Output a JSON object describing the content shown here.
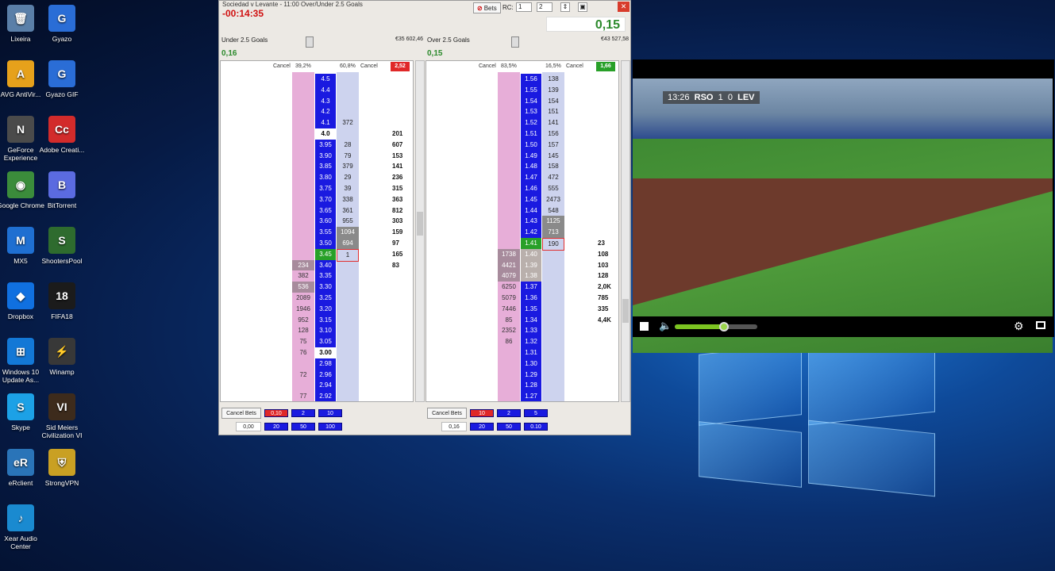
{
  "desktop_icons": [
    {
      "label": "Lixeira",
      "color": "#5a7fa8",
      "glyph": "🗑"
    },
    {
      "label": "Gyazo",
      "color": "#2a6dd6",
      "glyph": "G"
    },
    {
      "label": "AVG AntiVir...",
      "color": "#e6a11b",
      "glyph": "A"
    },
    {
      "label": "Gyazo GIF",
      "color": "#2a6dd6",
      "glyph": "G"
    },
    {
      "label": "GeForce Experience",
      "color": "#4b4b4b",
      "glyph": "N"
    },
    {
      "label": "Adobe Creati...",
      "color": "#d22b2b",
      "glyph": "Cc"
    },
    {
      "label": "Google Chrome",
      "color": "#3b8c3b",
      "glyph": "◉"
    },
    {
      "label": "BitTorrent",
      "color": "#5b6be0",
      "glyph": "B"
    },
    {
      "label": "MX5",
      "color": "#1f6fd1",
      "glyph": "M"
    },
    {
      "label": "ShootersPool",
      "color": "#2e6b2e",
      "glyph": "S"
    },
    {
      "label": "Dropbox",
      "color": "#1070e0",
      "glyph": "◆"
    },
    {
      "label": "FIFA18",
      "color": "#1b1b1b",
      "glyph": "18"
    },
    {
      "label": "Windows 10 Update As...",
      "color": "#1378d6",
      "glyph": "⊞"
    },
    {
      "label": "Winamp",
      "color": "#383838",
      "glyph": "⚡"
    },
    {
      "label": "Skype",
      "color": "#1ca1e6",
      "glyph": "S"
    },
    {
      "label": "Sid Meiers Civilization VI",
      "color": "#3d2b1c",
      "glyph": "VI"
    },
    {
      "label": "eRclient",
      "color": "#2a74b8",
      "glyph": "eR"
    },
    {
      "label": "StrongVPN",
      "color": "#c9a023",
      "glyph": "⛨"
    },
    {
      "label": "Xear Audio Center",
      "color": "#1a8ad0",
      "glyph": "♪"
    }
  ],
  "window": {
    "title": "Sociedad v Levante - 11:00 Over/Under 2.5 Goals",
    "timer": "-00:14:35",
    "bets_label": "Bets",
    "rc_label": "RC:",
    "rc1": "1",
    "rc2": "2",
    "close": "✕",
    "top_value": "0,15"
  },
  "under": {
    "name": "Under 2.5 Goals",
    "amount": "€35 602,46",
    "pl": "0,16",
    "head": {
      "cancel1": "Cancel",
      "pct1": "39,2%",
      "pct2": "60,8%",
      "cancel2": "Cancel",
      "badge": "2,52"
    },
    "rows": [
      {
        "odds": "4.5",
        "lay": "",
        "back": "",
        "vol": ""
      },
      {
        "odds": "4.4",
        "lay": "",
        "back": "",
        "vol": ""
      },
      {
        "odds": "4.3",
        "lay": "",
        "back": "",
        "vol": ""
      },
      {
        "odds": "4.2",
        "lay": "",
        "back": "",
        "vol": ""
      },
      {
        "odds": "4.1",
        "lay": "",
        "back": "372",
        "vol": ""
      },
      {
        "odds": "4.0",
        "lay": "",
        "back": "",
        "vol": "201",
        "style": "white"
      },
      {
        "odds": "3.95",
        "lay": "",
        "back": "28",
        "vol": "607"
      },
      {
        "odds": "3.90",
        "lay": "",
        "back": "79",
        "vol": "153"
      },
      {
        "odds": "3.85",
        "lay": "",
        "back": "379",
        "vol": "141"
      },
      {
        "odds": "3.80",
        "lay": "",
        "back": "29",
        "vol": "236"
      },
      {
        "odds": "3.75",
        "lay": "",
        "back": "39",
        "vol": "315"
      },
      {
        "odds": "3.70",
        "lay": "",
        "back": "338",
        "vol": "363"
      },
      {
        "odds": "3.65",
        "lay": "",
        "back": "361",
        "vol": "812"
      },
      {
        "odds": "3.60",
        "lay": "",
        "back": "955",
        "vol": "303"
      },
      {
        "odds": "3.55",
        "lay": "",
        "back": "1094",
        "vol": "159",
        "backstyle": "dark"
      },
      {
        "odds": "3.50",
        "lay": "",
        "back": "694",
        "vol": "97",
        "backstyle": "dark"
      },
      {
        "odds": "3.45",
        "lay": "",
        "back": "1",
        "vol": "165",
        "style": "green",
        "backstyle": "red"
      },
      {
        "odds": "3.40",
        "lay": "234",
        "back": "",
        "vol": "83",
        "laystyle": "dark"
      },
      {
        "odds": "3.35",
        "lay": "382",
        "back": "",
        "vol": ""
      },
      {
        "odds": "3.30",
        "lay": "536",
        "back": "",
        "vol": "",
        "laystyle": "dark"
      },
      {
        "odds": "3.25",
        "lay": "2089",
        "back": "",
        "vol": ""
      },
      {
        "odds": "3.20",
        "lay": "1946",
        "back": "",
        "vol": ""
      },
      {
        "odds": "3.15",
        "lay": "952",
        "back": "",
        "vol": ""
      },
      {
        "odds": "3.10",
        "lay": "128",
        "back": "",
        "vol": ""
      },
      {
        "odds": "3.05",
        "lay": "75",
        "back": "",
        "vol": ""
      },
      {
        "odds": "3.00",
        "lay": "76",
        "back": "",
        "vol": "",
        "style": "white"
      },
      {
        "odds": "2.98",
        "lay": "",
        "back": "",
        "vol": ""
      },
      {
        "odds": "2.96",
        "lay": "72",
        "back": "",
        "vol": ""
      },
      {
        "odds": "2.94",
        "lay": "",
        "back": "",
        "vol": ""
      },
      {
        "odds": "2.92",
        "lay": "77",
        "back": "",
        "vol": ""
      }
    ],
    "footer": {
      "cancel_bets": "Cancel Bets",
      "input": "0,00",
      "stakes_top": [
        "0,10",
        "2",
        "10"
      ],
      "stakes_bottom": [
        "20",
        "50",
        "100"
      ]
    }
  },
  "over": {
    "name": "Over 2.5 Goals",
    "amount": "€43 527,58",
    "pl": "0,15",
    "head": {
      "cancel1": "Cancel",
      "pct1": "83,5%",
      "pct2": "16,5%",
      "cancel2": "Cancel",
      "badge": "1,66"
    },
    "rows": [
      {
        "odds": "1.56",
        "lay": "",
        "back": "138",
        "vol": ""
      },
      {
        "odds": "1.55",
        "lay": "",
        "back": "139",
        "vol": ""
      },
      {
        "odds": "1.54",
        "lay": "",
        "back": "154",
        "vol": ""
      },
      {
        "odds": "1.53",
        "lay": "",
        "back": "151",
        "vol": ""
      },
      {
        "odds": "1.52",
        "lay": "",
        "back": "141",
        "vol": ""
      },
      {
        "odds": "1.51",
        "lay": "",
        "back": "156",
        "vol": ""
      },
      {
        "odds": "1.50",
        "lay": "",
        "back": "157",
        "vol": ""
      },
      {
        "odds": "1.49",
        "lay": "",
        "back": "145",
        "vol": ""
      },
      {
        "odds": "1.48",
        "lay": "",
        "back": "158",
        "vol": ""
      },
      {
        "odds": "1.47",
        "lay": "",
        "back": "472",
        "vol": ""
      },
      {
        "odds": "1.46",
        "lay": "",
        "back": "555",
        "vol": ""
      },
      {
        "odds": "1.45",
        "lay": "",
        "back": "2473",
        "vol": ""
      },
      {
        "odds": "1.44",
        "lay": "",
        "back": "548",
        "vol": ""
      },
      {
        "odds": "1.43",
        "lay": "",
        "back": "1125",
        "vol": "",
        "backstyle": "dark"
      },
      {
        "odds": "1.42",
        "lay": "",
        "back": "713",
        "vol": "",
        "backstyle": "dark"
      },
      {
        "odds": "1.41",
        "lay": "",
        "back": "190",
        "vol": "23",
        "style": "green",
        "backstyle": "red"
      },
      {
        "odds": "1.40",
        "lay": "1738",
        "back": "",
        "vol": "108",
        "style": "grey",
        "laystyle": "dark"
      },
      {
        "odds": "1.39",
        "lay": "4421",
        "back": "",
        "vol": "103",
        "style": "grey",
        "laystyle": "dark"
      },
      {
        "odds": "1.38",
        "lay": "4079",
        "back": "",
        "vol": "128",
        "style": "grey",
        "laystyle": "dark"
      },
      {
        "odds": "1.37",
        "lay": "6250",
        "back": "",
        "vol": "2,0K"
      },
      {
        "odds": "1.36",
        "lay": "5079",
        "back": "",
        "vol": "785"
      },
      {
        "odds": "1.35",
        "lay": "7446",
        "back": "",
        "vol": "335"
      },
      {
        "odds": "1.34",
        "lay": "85",
        "back": "",
        "vol": "4,4K"
      },
      {
        "odds": "1.33",
        "lay": "2352",
        "back": "",
        "vol": ""
      },
      {
        "odds": "1.32",
        "lay": "86",
        "back": "",
        "vol": ""
      },
      {
        "odds": "1.31",
        "lay": "",
        "back": "",
        "vol": ""
      },
      {
        "odds": "1.30",
        "lay": "",
        "back": "",
        "vol": ""
      },
      {
        "odds": "1.29",
        "lay": "",
        "back": "",
        "vol": ""
      },
      {
        "odds": "1.28",
        "lay": "",
        "back": "",
        "vol": ""
      },
      {
        "odds": "1.27",
        "lay": "",
        "back": "",
        "vol": ""
      }
    ],
    "footer": {
      "cancel_bets": "Cancel Bets",
      "input": "0,16",
      "stakes_top": [
        "10",
        "2",
        "5"
      ],
      "stakes_bottom": [
        "20",
        "50",
        "0.10"
      ]
    }
  },
  "video": {
    "score_time": "13:26",
    "home": "RSO",
    "home_goals": "1",
    "away_goals": "0",
    "away": "LEV",
    "volume_fraction": 0.6
  },
  "colors": {
    "accent_green": "#2c8a2c",
    "odds_blue": "#1a1ae0",
    "pink": "#e7aed8",
    "red": "#e02828"
  }
}
